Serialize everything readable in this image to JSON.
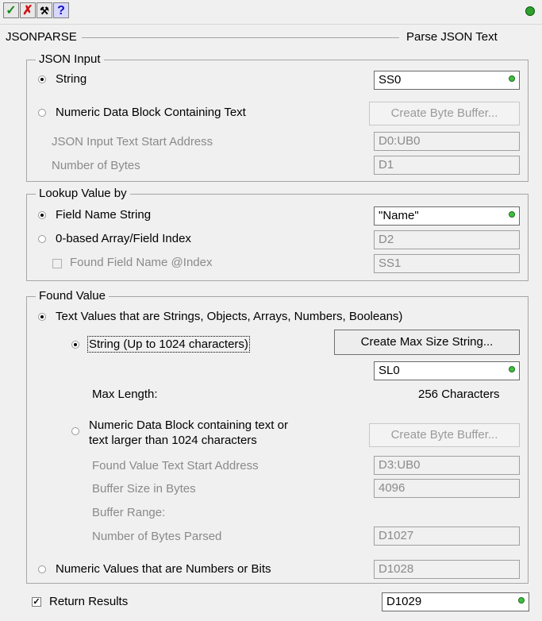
{
  "toolbar": {
    "ok_glyph": "✓",
    "cancel_glyph": "✗",
    "tool_glyph": "⚒",
    "help_glyph": "?"
  },
  "header": {
    "instruction": "JSONPARSE",
    "description": "Parse JSON Text"
  },
  "json_input": {
    "title": "JSON Input",
    "string_label": "String",
    "string_value": "SS0",
    "numeric_label": "Numeric Data Block Containing Text",
    "create_byte_buffer": "Create Byte Buffer...",
    "start_address_label": "JSON Input Text Start Address",
    "start_address_value": "D0:UB0",
    "num_bytes_label": "Number of Bytes",
    "num_bytes_value": "D1"
  },
  "lookup": {
    "title": "Lookup Value by",
    "field_name_label": "Field Name String",
    "field_name_value": "\"Name\"",
    "index_label": "0-based Array/Field Index",
    "index_value": "D2",
    "found_field_label": "Found Field Name @Index",
    "found_field_value": "SS1"
  },
  "found": {
    "title": "Found Value",
    "text_values_label": "Text Values that are Strings, Objects, Arrays, Numbers, Booleans)",
    "string_label": "String (Up to 1024 characters)",
    "create_max_string": "Create Max Size String...",
    "string_value": "SL0",
    "max_length_label": "Max Length:",
    "max_length_value": "256 Characters",
    "numeric_block_label_1": "Numeric Data Block containing text or",
    "numeric_block_label_2": "text larger than 1024 characters",
    "create_byte_buffer": "Create Byte Buffer...",
    "start_address_label": "Found Value Text Start Address",
    "start_address_value": "D3:UB0",
    "buffer_size_label": "Buffer Size in Bytes",
    "buffer_size_value": "4096",
    "buffer_range_label": "Buffer Range:",
    "bytes_parsed_label": "Number of Bytes Parsed",
    "bytes_parsed_value": "D1027",
    "numeric_values_label": "Numeric Values that are Numbers or Bits",
    "numeric_values_value": "D1028"
  },
  "return_results": {
    "label": "Return Results",
    "checked_glyph": "✓",
    "value": "D1029"
  },
  "colors": {
    "status_led": "#2ea12e",
    "valid_dot": "#3fbf3f"
  }
}
